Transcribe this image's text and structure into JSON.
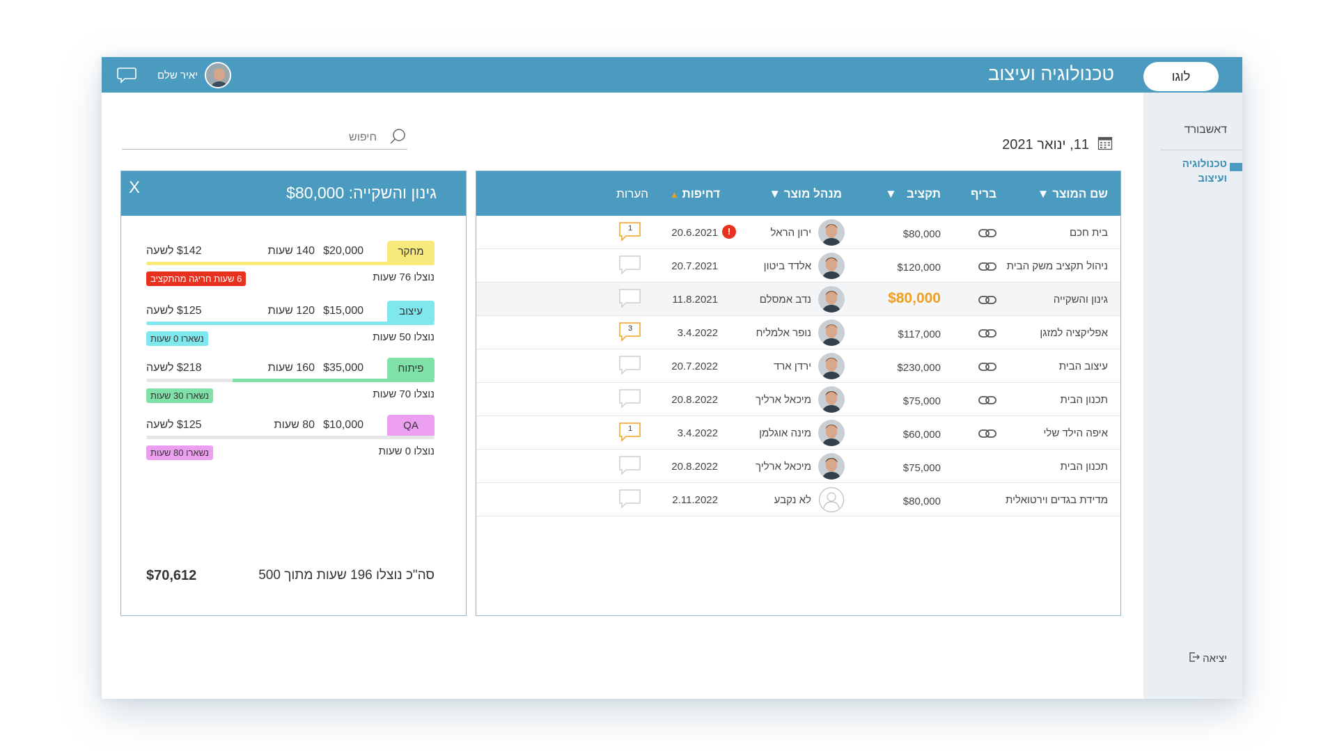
{
  "header": {
    "logo_label": "לוגו",
    "title": "טכנולוגיה ועיצוב",
    "user_name": "יאיר שלם"
  },
  "sidebar": {
    "items": [
      {
        "label": "דאשבורד"
      },
      {
        "label": "טכנולוגיה ועיצוב"
      }
    ],
    "logout_label": "יציאה"
  },
  "toolbar": {
    "date": "11, ינואר 2021",
    "search_placeholder": "חיפוש"
  },
  "table": {
    "columns": {
      "product": "שם המוצר",
      "brief": "בריף",
      "budget": "תקציב",
      "manager": "מנהל מוצר",
      "urgency": "דחיפות",
      "comments": "הערות"
    },
    "rows": [
      {
        "product": "בית חכם",
        "brief": true,
        "budget": "$80,000",
        "manager": "ירון הראל",
        "date": "20.6.2021",
        "alert": "!",
        "comments": "1",
        "avatar_color": "#8a5a3c",
        "selected": false
      },
      {
        "product": "ניהול תקציב משק הבית",
        "brief": true,
        "budget": "$120,000",
        "manager": "אלדד ביטון",
        "date": "20.7.2021",
        "alert": "",
        "comments": "",
        "avatar_color": "#6b4a34",
        "selected": false
      },
      {
        "product": "גינון והשקייה",
        "brief": true,
        "budget": "$80,000",
        "manager": "נדב אמסלם",
        "date": "11.8.2021",
        "alert": "",
        "comments": "",
        "avatar_color": "#7a5038",
        "selected": true
      },
      {
        "product": "אפליקציה למזגן",
        "brief": true,
        "budget": "$117,000",
        "manager": "נופר אלמליח",
        "date": "3.4.2022",
        "alert": "",
        "comments": "3",
        "avatar_color": "#9b6a4e",
        "selected": false
      },
      {
        "product": "עיצוב הבית",
        "brief": true,
        "budget": "$230,000",
        "manager": "ירדן ארד",
        "date": "20.7.2022",
        "alert": "",
        "comments": "",
        "avatar_color": "#8c6048",
        "selected": false
      },
      {
        "product": "תכנון הבית",
        "brief": true,
        "budget": "$75,000",
        "manager": "מיכאל ארליך",
        "date": "20.8.2022",
        "alert": "",
        "comments": "",
        "avatar_color": "#5c3e2c",
        "selected": false
      },
      {
        "product": "איפה הילד שלי",
        "brief": true,
        "budget": "$60,000",
        "manager": "מינה אוגלמן",
        "date": "3.4.2022",
        "alert": "",
        "comments": "1",
        "avatar_color": "#8e5d45",
        "selected": false
      },
      {
        "product": "תכנון הבית",
        "brief": false,
        "budget": "$75,000",
        "manager": "מיכאל ארליך",
        "date": "20.8.2022",
        "alert": "",
        "comments": "",
        "avatar_color": "#4e3426",
        "selected": false
      },
      {
        "product": "מדידת בגדים וירטואלית",
        "brief": false,
        "budget": "$80,000",
        "manager": "לא נקבע",
        "date": "2.11.2022",
        "alert": "",
        "comments": "",
        "avatar_color": "",
        "selected": false
      }
    ]
  },
  "detail": {
    "title": "גינון והשקייה: $80,000",
    "close_label": "X",
    "categories": [
      {
        "tag": "מחקר",
        "tag_color": "#f7ea7a",
        "budget": "$20,000",
        "hours": "140 שעות",
        "rate": "$142 לשעה",
        "used": "נוצלו 76 שעות",
        "badge": "6 שעות חריגה מהתקציב",
        "badge_bg": "#e8321f",
        "badge_fg": "#ffffff",
        "bar_color": "#f7ea7a",
        "progress": 1.0
      },
      {
        "tag": "עיצוב",
        "tag_color": "#7fe8ee",
        "budget": "$15,000",
        "hours": "120 שעות",
        "rate": "$125 לשעה",
        "used": "נוצלו 50 שעות",
        "badge": "נשארו 0 שעות",
        "badge_bg": "#7fe8ee",
        "badge_fg": "#333333",
        "bar_color": "#7fe8ee",
        "progress": 1.0
      },
      {
        "tag": "פיתוח",
        "tag_color": "#7fe0a8",
        "budget": "$35,000",
        "hours": "160 שעות",
        "rate": "$218 לשעה",
        "used": "נוצלו 70 שעות",
        "badge": "נשארו 30 שעות",
        "badge_bg": "#7fe0a8",
        "badge_fg": "#333333",
        "bar_color": "#7fe0a8",
        "progress": 0.7
      },
      {
        "tag": "QA",
        "tag_color": "#ec9ef0",
        "budget": "$10,000",
        "hours": "80 שעות",
        "rate": "$125 לשעה",
        "used": "נוצלו 0 שעות",
        "badge": "נשארו 80 שעות",
        "badge_bg": "#ec9ef0",
        "badge_fg": "#333333",
        "bar_color": "#ec9ef0",
        "progress": 0.0
      }
    ],
    "total_text": "סה\"כ נוצלו 196 שעות מתוך 500",
    "total_amount": "$70,612"
  },
  "colors": {
    "accent": "#4a9bbf",
    "highlight_budget": "#f0a020",
    "alert": "#e8321f",
    "comment_active": "#f0a020"
  }
}
